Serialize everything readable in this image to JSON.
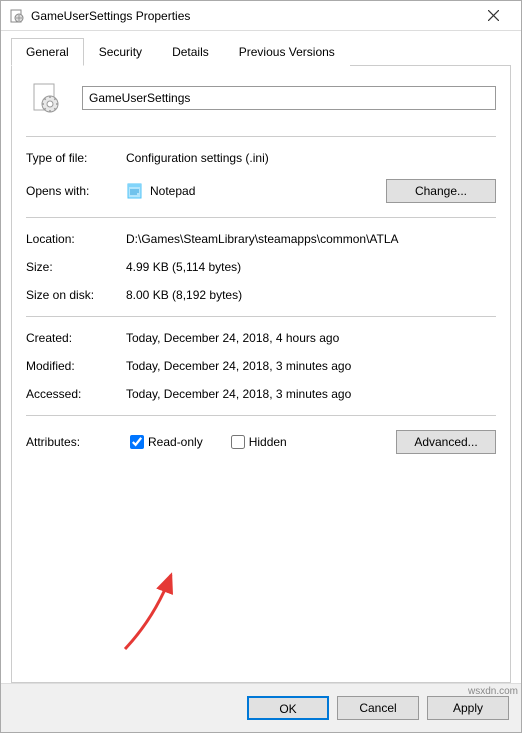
{
  "window": {
    "title": "GameUserSettings Properties"
  },
  "tabs": {
    "general": "General",
    "security": "Security",
    "details": "Details",
    "previous": "Previous Versions"
  },
  "file": {
    "name": "GameUserSettings"
  },
  "labels": {
    "type_of_file": "Type of file:",
    "opens_with": "Opens with:",
    "location": "Location:",
    "size": "Size:",
    "size_on_disk": "Size on disk:",
    "created": "Created:",
    "modified": "Modified:",
    "accessed": "Accessed:",
    "attributes": "Attributes:"
  },
  "values": {
    "type_of_file": "Configuration settings (.ini)",
    "opens_with": "Notepad",
    "location": "D:\\Games\\SteamLibrary\\steamapps\\common\\ATLA",
    "size": "4.99 KB (5,114 bytes)",
    "size_on_disk": "8.00 KB (8,192 bytes)",
    "created": "Today, December 24, 2018, 4 hours ago",
    "modified": "Today, December 24, 2018, 3 minutes ago",
    "accessed": "Today, December 24, 2018, 3 minutes ago"
  },
  "buttons": {
    "change": "Change...",
    "advanced": "Advanced...",
    "ok": "OK",
    "cancel": "Cancel",
    "apply": "Apply"
  },
  "attributes": {
    "readonly_label": "Read-only",
    "readonly_checked": "checked",
    "hidden_label": "Hidden"
  },
  "watermark": "wsxdn.com"
}
